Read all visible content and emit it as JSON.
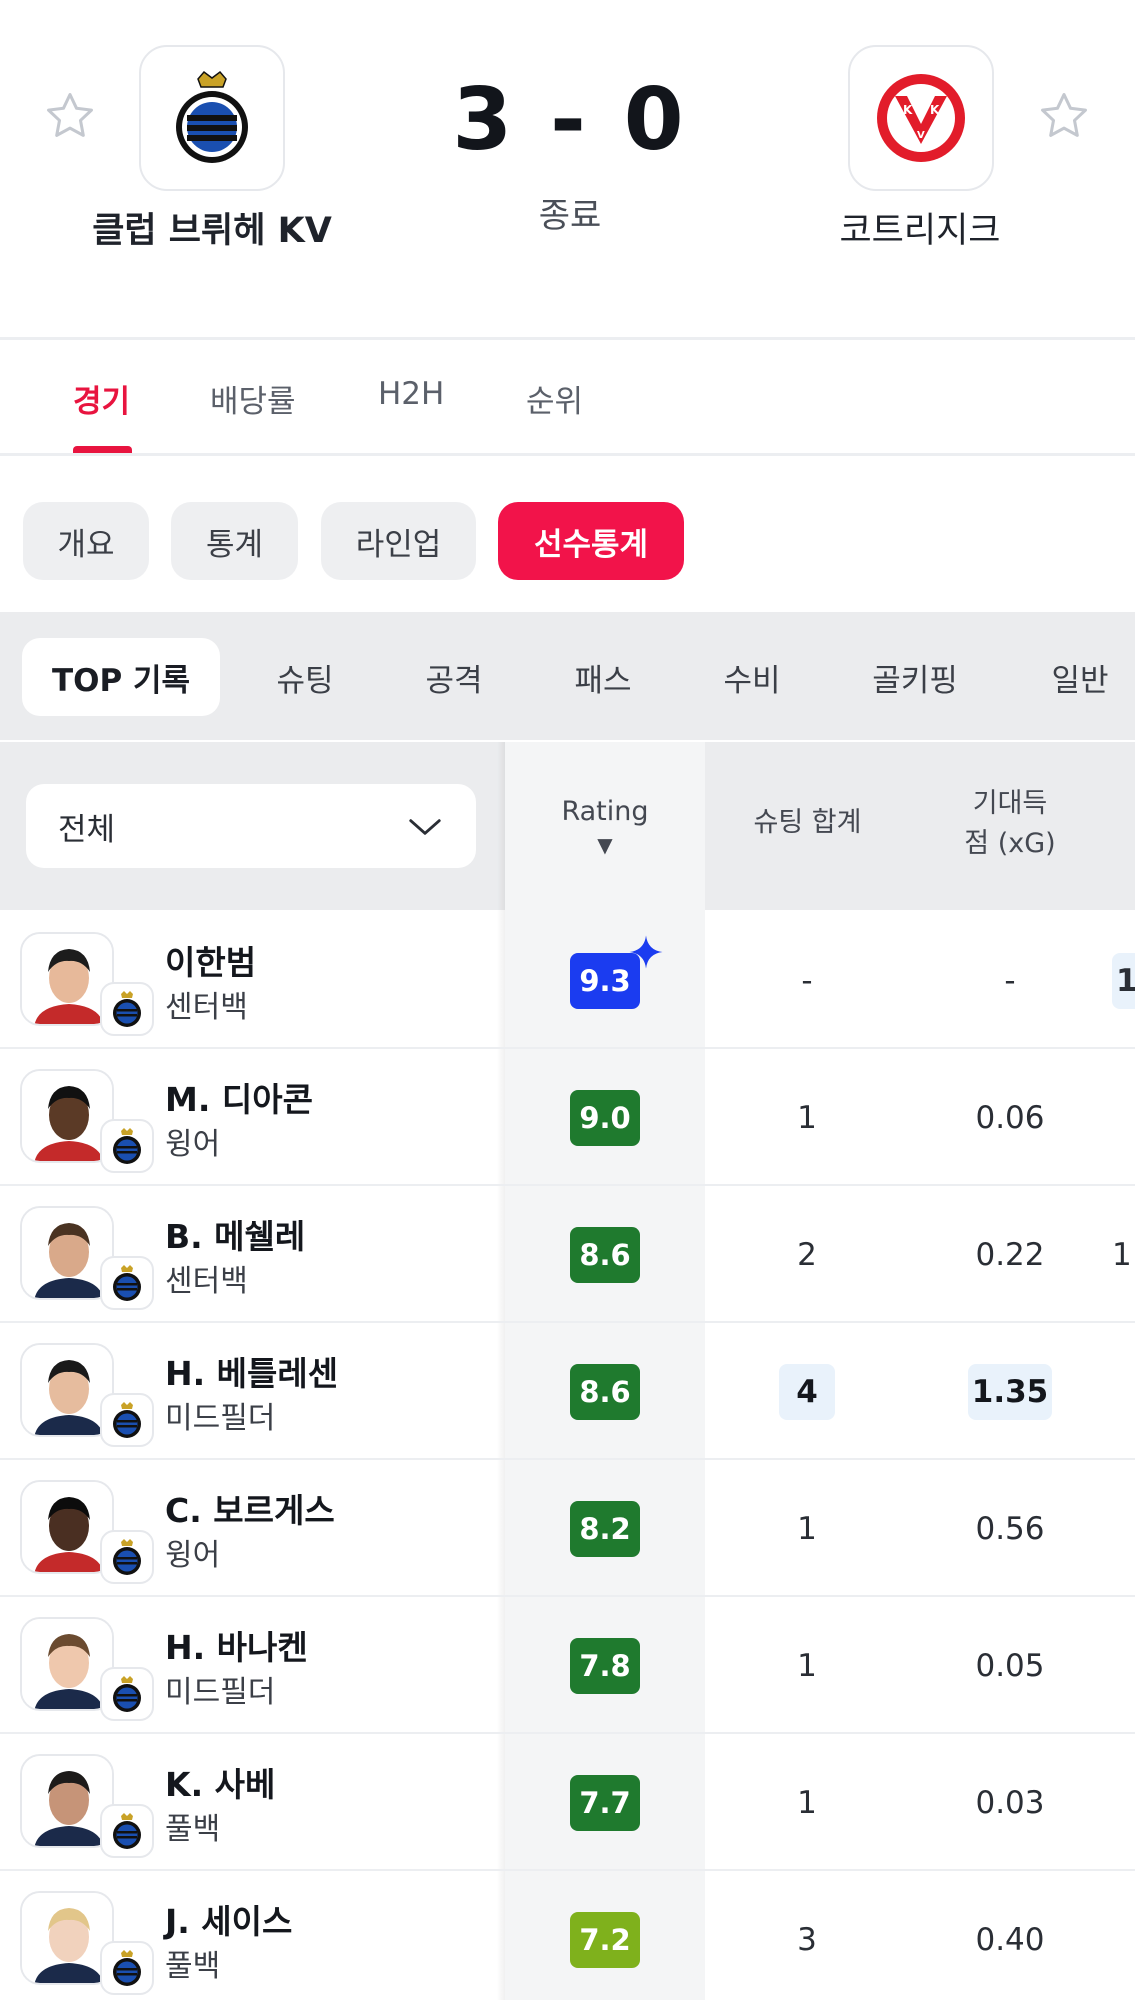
{
  "match": {
    "home_team": "클럽 브뤼헤 KV",
    "away_team": "코트리지크",
    "score": "3 - 0",
    "status": "종료"
  },
  "main_tabs": [
    {
      "label": "경기",
      "active": true
    },
    {
      "label": "배당률",
      "active": false
    },
    {
      "label": "H2H",
      "active": false
    },
    {
      "label": "순위",
      "active": false
    }
  ],
  "sub_tabs": [
    {
      "label": "개요",
      "active": false
    },
    {
      "label": "통계",
      "active": false
    },
    {
      "label": "라인업",
      "active": false
    },
    {
      "label": "선수통계",
      "active": true
    }
  ],
  "category_tabs": [
    {
      "label": "TOP 기록",
      "active": true
    },
    {
      "label": "슈팅",
      "active": false
    },
    {
      "label": "공격",
      "active": false
    },
    {
      "label": "패스",
      "active": false
    },
    {
      "label": "수비",
      "active": false
    },
    {
      "label": "골키핑",
      "active": false
    },
    {
      "label": "일반",
      "active": false
    }
  ],
  "table": {
    "filter_value": "전체",
    "columns": {
      "rating": "Rating",
      "rating_sort": "▼",
      "shots": "슈팅 합계",
      "xg_line1": "기대득",
      "xg_line2": "점 (xG)"
    },
    "players": [
      {
        "name": "이한범",
        "position": "센터백",
        "rating": "9.3",
        "shots": "-",
        "xg": "-",
        "extra": "1"
      },
      {
        "name": "M. 디아콘",
        "position": "윙어",
        "rating": "9.0",
        "shots": "1",
        "xg": "0.06",
        "extra": ""
      },
      {
        "name": "B. 메쉘레",
        "position": "센터백",
        "rating": "8.6",
        "shots": "2",
        "xg": "0.22",
        "extra": "1"
      },
      {
        "name": "H. 베틀레센",
        "position": "미드필더",
        "rating": "8.6",
        "shots": "4",
        "xg": "1.35",
        "extra": ""
      },
      {
        "name": "C. 보르게스",
        "position": "윙어",
        "rating": "8.2",
        "shots": "1",
        "xg": "0.56",
        "extra": ""
      },
      {
        "name": "H. 바나켄",
        "position": "미드필더",
        "rating": "7.8",
        "shots": "1",
        "xg": "0.05",
        "extra": ""
      },
      {
        "name": "K. 사베",
        "position": "풀백",
        "rating": "7.7",
        "shots": "1",
        "xg": "0.03",
        "extra": ""
      },
      {
        "name": "J. 세이스",
        "position": "풀백",
        "rating": "7.2",
        "shots": "3",
        "xg": "0.40",
        "extra": ""
      }
    ]
  },
  "colors": {
    "accent": "#e8143f",
    "rating_top": "#1b3cf0",
    "rating_high": "#1f7a2e",
    "rating_mid": "#7fb11c",
    "highlight_cell": "#e9f2fb"
  },
  "icons": {
    "favorite": "star-outline-icon",
    "filter": "chevron-down-icon",
    "top_rating": "sparkle-icon"
  }
}
